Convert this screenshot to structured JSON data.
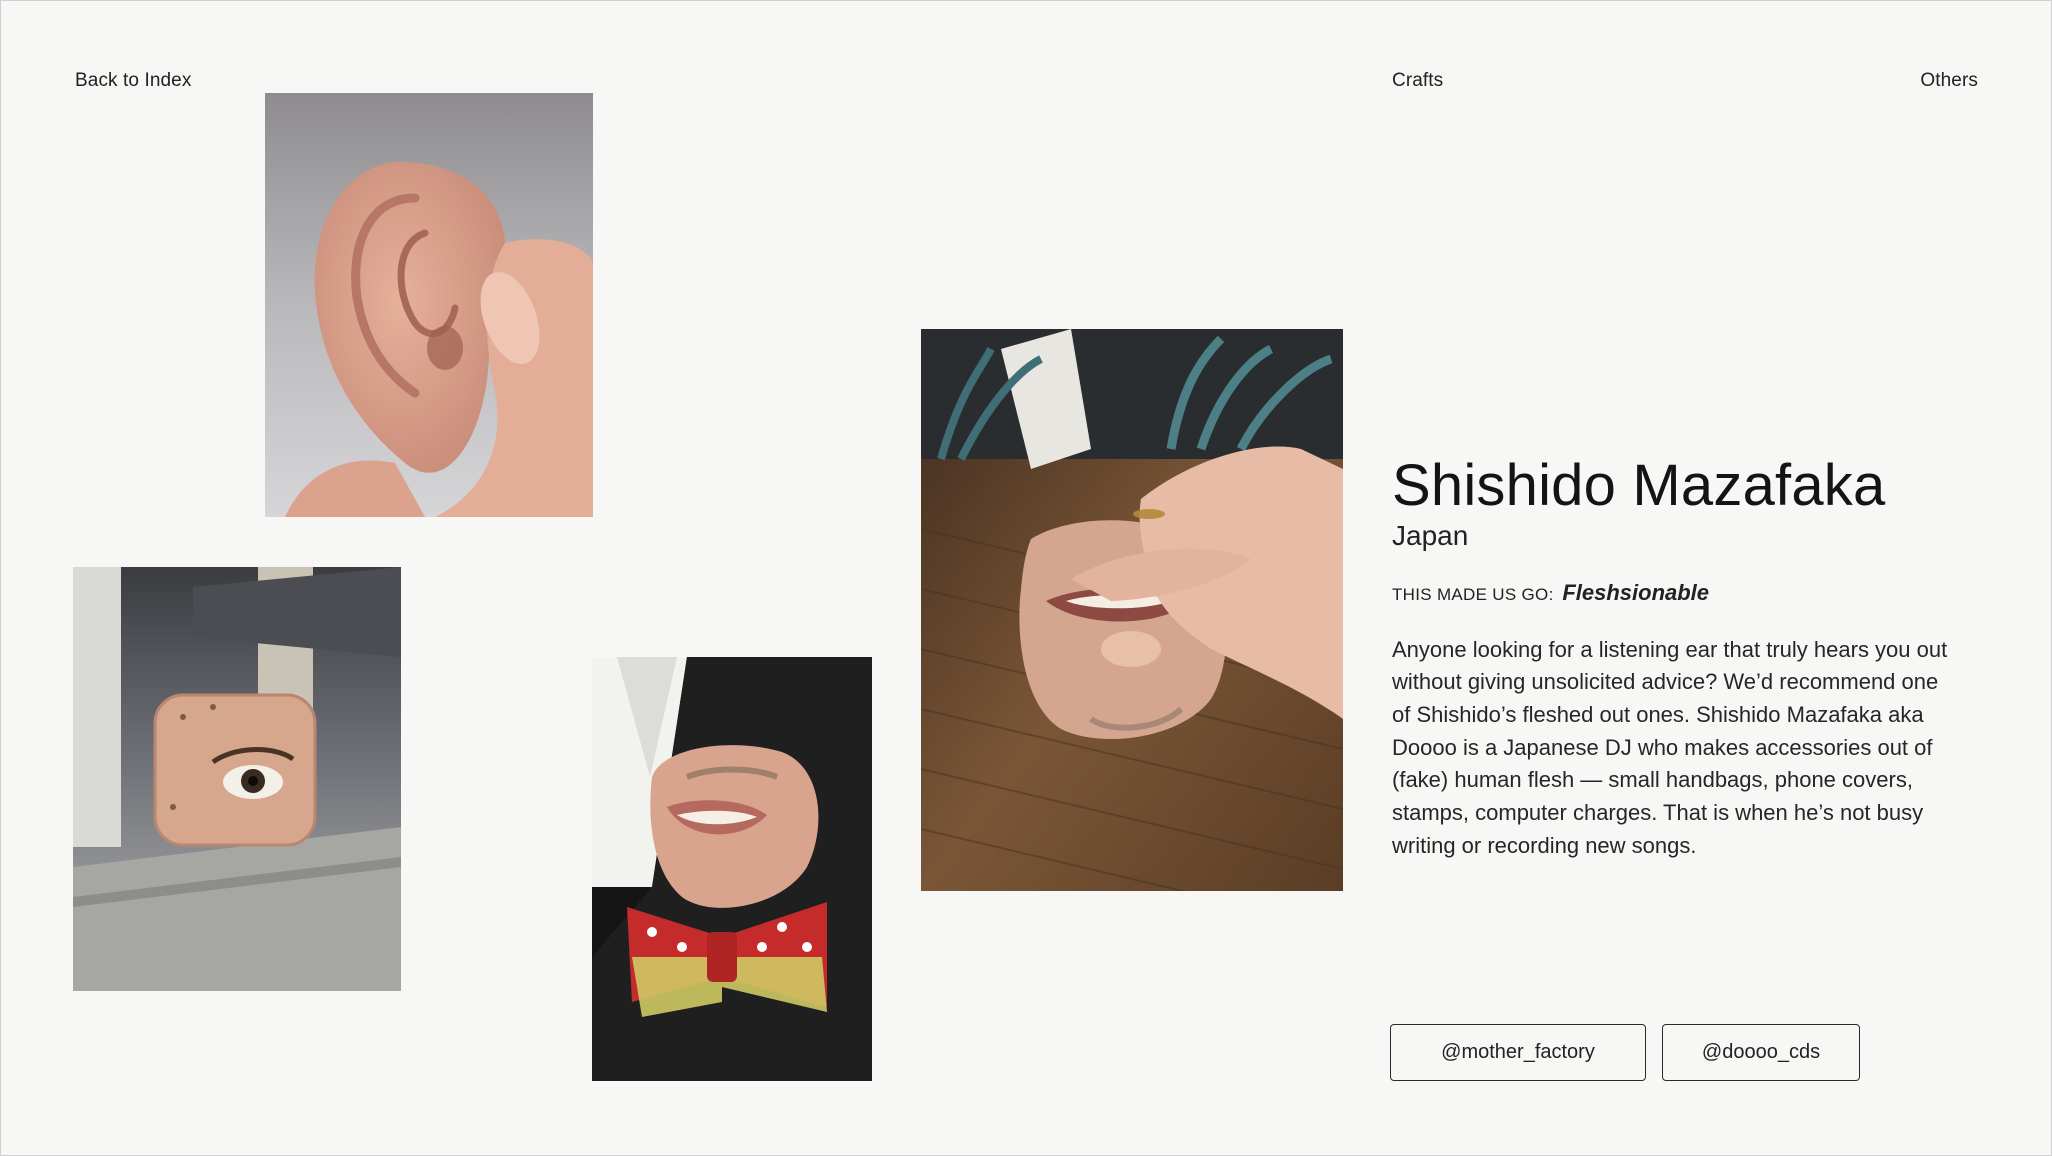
{
  "nav": {
    "back_label": "Back to Index",
    "crafts_label": "Crafts",
    "others_label": "Others"
  },
  "artist": {
    "name": "Shishido Mazafaka",
    "country": "Japan",
    "tagline_label": "THIS MADE US GO:",
    "tagline_value": "Fleshsionable",
    "description": "Anyone looking for a listening ear that truly hears you out without giving unsolicited advice? We’d recommend one of Shishido’s fleshed out ones. Shishido Mazafaka aka Doooo is a Japanese DJ who makes accessories out of (fake) human flesh — small handbags, phone covers, stamps, computer charges. That is when he’s not busy writing or recording new songs."
  },
  "social": {
    "handles": [
      "@mother_factory",
      "@doooo_cds"
    ]
  },
  "photos": {
    "ear": "flesh-ear-photo",
    "cube": "flesh-eye-cube-photo",
    "bowtie": "flesh-mouth-bowtie-photo",
    "mouth": "flesh-mouth-hand-photo"
  },
  "colors": {
    "background": "#f7f7f5",
    "text": "#1a1a1a",
    "skin": "#e2ad99"
  }
}
